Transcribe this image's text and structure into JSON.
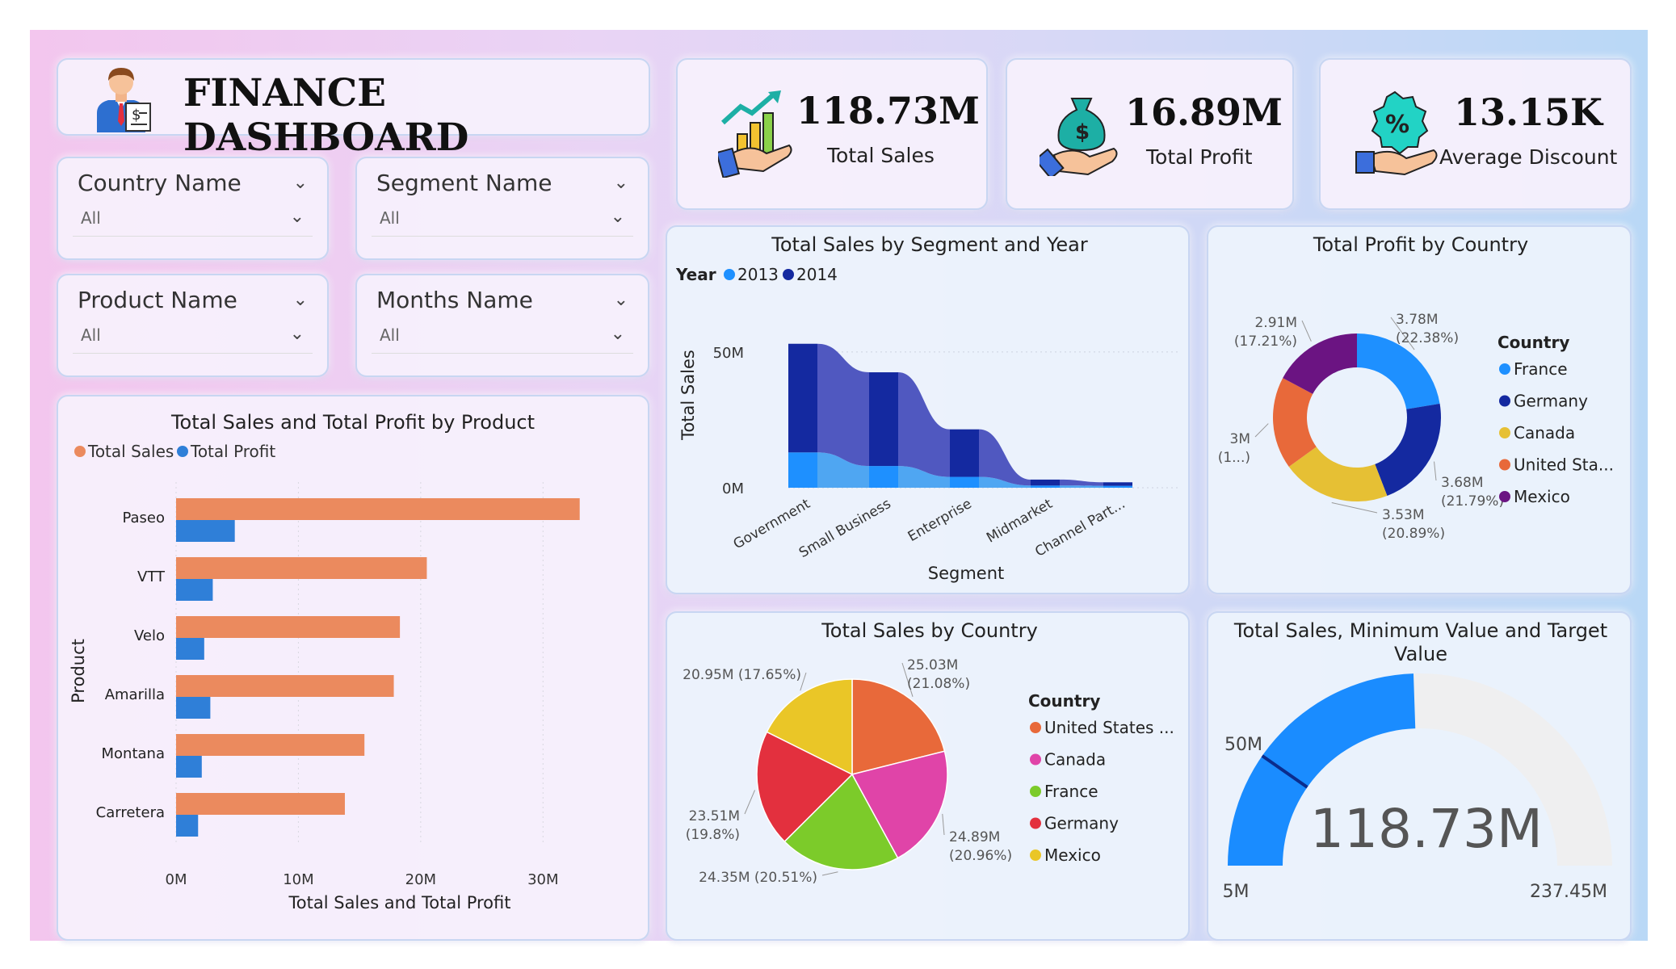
{
  "header": {
    "title": "FINANCE DASHBOARD",
    "icon": "businessman-icon"
  },
  "slicers": [
    {
      "label": "Country Name",
      "value": "All"
    },
    {
      "label": "Segment Name",
      "value": "All"
    },
    {
      "label": "Product Name",
      "value": "All"
    },
    {
      "label": "Months Name",
      "value": "All"
    }
  ],
  "kpis": [
    {
      "value": "118.73M",
      "label": "Total Sales",
      "icon": "sales-growth-icon"
    },
    {
      "value": "16.89M",
      "label": "Total Profit",
      "icon": "money-bag-hand-icon"
    },
    {
      "value": "13.15K",
      "label": "Average Discount",
      "icon": "discount-hand-icon"
    }
  ],
  "colors": {
    "sales": "#EB8A5E",
    "profit": "#2F7FD8",
    "y2013": "#1E90FF",
    "y2014": "#1429A0"
  },
  "chart_data": [
    {
      "id": "product",
      "type": "bar",
      "orientation": "horizontal",
      "title": "Total Sales and Total Profit by Product",
      "legend": [
        "Total Sales",
        "Total Profit"
      ],
      "categories": [
        "Paseo",
        "VTT",
        "Velo",
        "Amarilla",
        "Montana",
        "Carretera"
      ],
      "series": [
        {
          "name": "Total Sales",
          "values": [
            33.0,
            20.5,
            18.3,
            17.8,
            15.4,
            13.8
          ]
        },
        {
          "name": "Total Profit",
          "values": [
            4.8,
            3.0,
            2.3,
            2.8,
            2.1,
            1.8
          ]
        }
      ],
      "xlabel": "Total Sales and Total Profit",
      "ylabel": "Product",
      "xticks": [
        "0M",
        "10M",
        "20M",
        "30M"
      ],
      "xlim": [
        0,
        35
      ],
      "legend_position": "top-left"
    },
    {
      "id": "segment",
      "type": "bar",
      "stacked": true,
      "title": "Total Sales by Segment and Year",
      "legend_title": "Year",
      "legend": [
        "2013",
        "2014"
      ],
      "categories": [
        "Government",
        "Small Business",
        "Enterprise",
        "Midmarket",
        "Channel Part..."
      ],
      "series": [
        {
          "name": "2013",
          "values": [
            13.0,
            8.0,
            4.0,
            0.8,
            0.7
          ]
        },
        {
          "name": "2014",
          "values": [
            40.0,
            34.5,
            17.5,
            2.2,
            1.3
          ]
        }
      ],
      "xlabel": "Segment",
      "ylabel": "Total Sales",
      "yticks": [
        "0M",
        "50M"
      ],
      "ylim": [
        0,
        55
      ],
      "legend_position": "top-left"
    },
    {
      "id": "profit_country",
      "type": "pie",
      "donut": true,
      "title": "Total Profit by Country",
      "legend_title": "Country",
      "legend": [
        "France",
        "Germany",
        "Canada",
        "United Sta...",
        "Mexico"
      ],
      "values": [
        3.78,
        3.68,
        3.53,
        3.0,
        2.91
      ],
      "percents": [
        22.38,
        21.79,
        20.89,
        17.73,
        17.21
      ],
      "labels": [
        [
          "3.78M",
          "(22.38%)"
        ],
        [
          "3.68M",
          "(21.79%)"
        ],
        [
          "3.53M",
          "(20.89%)"
        ],
        [
          "3M",
          "(1...)"
        ],
        [
          "2.91M",
          "(17.21%)"
        ]
      ],
      "colors": [
        "#1E90FF",
        "#1429A0",
        "#E6C034",
        "#E8693A",
        "#6B1482"
      ],
      "legend_position": "right"
    },
    {
      "id": "sales_country",
      "type": "pie",
      "title": "Total Sales by Country",
      "legend_title": "Country",
      "legend": [
        "United States ...",
        "Canada",
        "France",
        "Germany",
        "Mexico"
      ],
      "values": [
        25.03,
        24.89,
        24.35,
        23.51,
        20.95
      ],
      "percents": [
        21.08,
        20.96,
        20.51,
        19.8,
        17.65
      ],
      "labels": [
        [
          "25.03M",
          "(21.08%)"
        ],
        [
          "24.89M",
          "(20.96%)"
        ],
        [
          "24.35M (20.51%)"
        ],
        [
          "23.51M",
          "(19.8%)"
        ],
        [
          "20.95M (17.65%)"
        ]
      ],
      "colors": [
        "#E8693A",
        "#E044A8",
        "#7CCB2A",
        "#E3303E",
        "#EAC627"
      ],
      "legend_position": "right"
    },
    {
      "id": "gauge",
      "type": "gauge",
      "title": "Total Sales, Minimum Value and Target Value",
      "value": 118.73,
      "value_label": "118.73M",
      "min": 5,
      "min_label": "5M",
      "max": 237.45,
      "max_label": "237.45M",
      "target": 50,
      "target_label": "50M"
    }
  ]
}
